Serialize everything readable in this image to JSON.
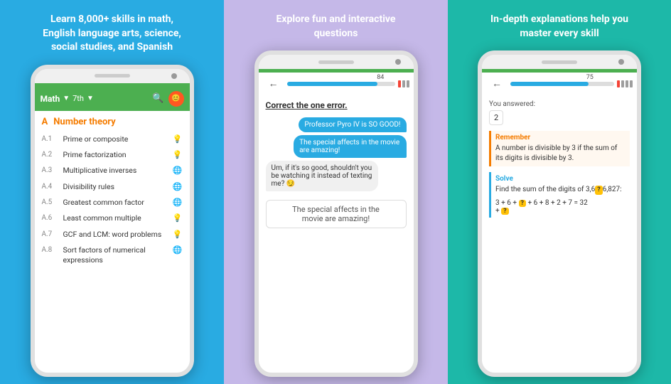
{
  "panel1": {
    "header": "Learn 8,000+ skills in math, English language arts, science, social studies, and Spanish",
    "toolbar": {
      "subject": "Math",
      "grade": "7th",
      "search_icon": "🔍",
      "avatar_initial": "😊"
    },
    "section": {
      "letter": "A",
      "title": "Number theory"
    },
    "items": [
      {
        "code": "A.1",
        "text": "Prime or composite",
        "icon": "💡"
      },
      {
        "code": "A.2",
        "text": "Prime factorization",
        "icon": "💡"
      },
      {
        "code": "A.3",
        "text": "Multiplicative inverses",
        "icon": "🌐"
      },
      {
        "code": "A.4",
        "text": "Divisibility rules",
        "icon": "🌐"
      },
      {
        "code": "A.5",
        "text": "Greatest common factor",
        "icon": "🌐"
      },
      {
        "code": "A.6",
        "text": "Least common multiple",
        "icon": "💡"
      },
      {
        "code": "A.7",
        "text": "GCF and LCM: word problems",
        "icon": "💡"
      },
      {
        "code": "A.8",
        "text": "Sort factors of numerical expressions",
        "icon": "🌐"
      }
    ]
  },
  "panel2": {
    "header": "Explore fun and interactive questions",
    "progress": 84,
    "question_prompt_before": "Correct the ",
    "question_prompt_emphasis": "one",
    "question_prompt_after": " error.",
    "chat": [
      {
        "side": "right",
        "text": "Professor Pyro IV is SO GOOD!"
      },
      {
        "side": "right",
        "text": "The special affects in the movie are amazing!"
      },
      {
        "side": "left",
        "text": "Um, if it's so good, shouldn't you be watching it instead of texting me? 😏"
      }
    ],
    "user_response": "The special affects in the\nmovie are amazing!"
  },
  "panel3": {
    "header": "In-depth explanations help you master every skill",
    "progress": 75,
    "you_answered_label": "You answered:",
    "answer_value": "2",
    "remember": {
      "title": "Remember",
      "text": "A number is divisible by 3 if the sum of its digits is divisible by 3."
    },
    "solve": {
      "title": "Solve",
      "text_before": "Find the sum of the digits of 3,6",
      "question_mark": "?",
      "text_after": "6,827:",
      "equation": "3 + 6 + ",
      "eq_qmark": "?",
      "eq_rest": " + 6 + 8 + 2 + 7 = 32",
      "eq_line2": "+ ",
      "eq_qmark2": "?"
    }
  }
}
